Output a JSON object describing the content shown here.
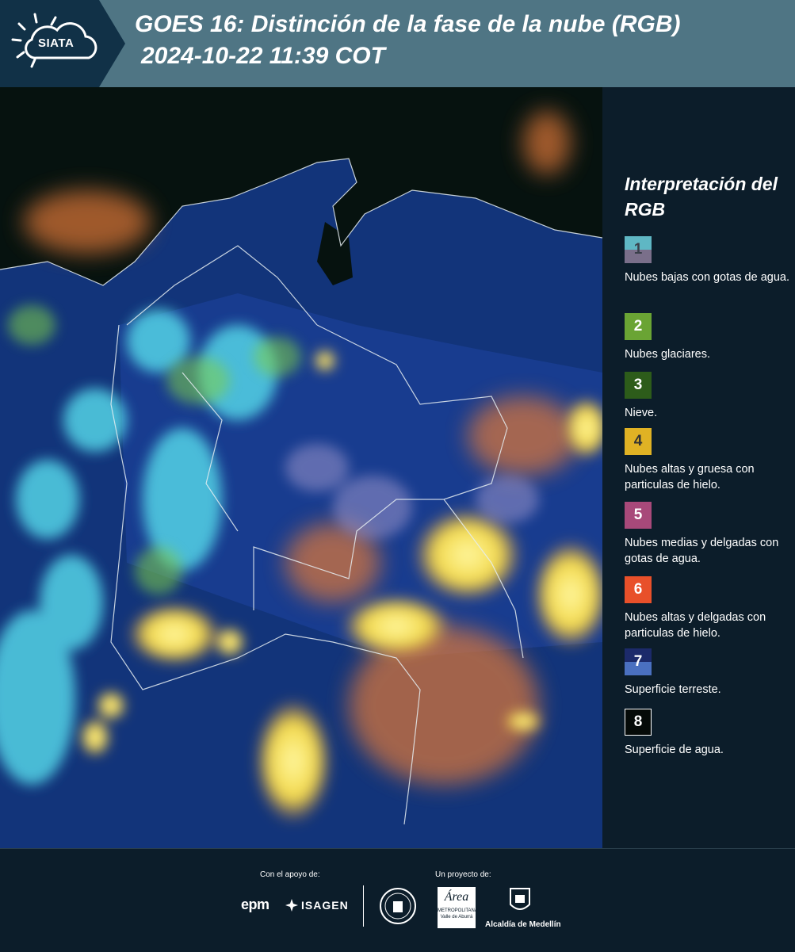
{
  "header": {
    "logo_text": "SIATA",
    "title_line1": "GOES 16: Distinción de la fase de la nube (RGB)",
    "title_line2": "2024-10-22 11:39 COT",
    "bg_color": "#4f7584",
    "logo_bg_color": "#113147"
  },
  "legend": {
    "title": "Interpretación del RGB",
    "items": [
      {
        "number": "1",
        "label": "Nubes bajas con gotas de agua.",
        "color_top": "#5fb7c4",
        "color_bottom": "#7a6f8a"
      },
      {
        "number": "2",
        "label": "Nubes glaciares.",
        "color": "#6aa434"
      },
      {
        "number": "3",
        "label": "Nieve.",
        "color": "#2d5c1a"
      },
      {
        "number": "4",
        "label": "Nubes altas y gruesa con particulas de hielo.",
        "color": "#e0b224"
      },
      {
        "number": "5",
        "label": "Nubes medias y delgadas con gotas de agua.",
        "color": "#a8497a"
      },
      {
        "number": "6",
        "label": "Nubes altas y delgadas con particulas de hielo.",
        "color": "#e8502a"
      },
      {
        "number": "7",
        "label": "Superficie terreste.",
        "color_top": "#1c2a6a",
        "color_bottom": "#4a70c0"
      },
      {
        "number": "8",
        "label": "Superficie de agua.",
        "color": "#050a08"
      }
    ]
  },
  "footer": {
    "support_label": "Con el apoyo de:",
    "project_label": "Un proyecto de:",
    "partner_1": "epm",
    "partner_2": "ISAGEN",
    "org_1_line1": "METROPOLITANA",
    "org_1_line2": "Valle de Aburrá",
    "org_2": "Alcaldía de Medellín"
  }
}
